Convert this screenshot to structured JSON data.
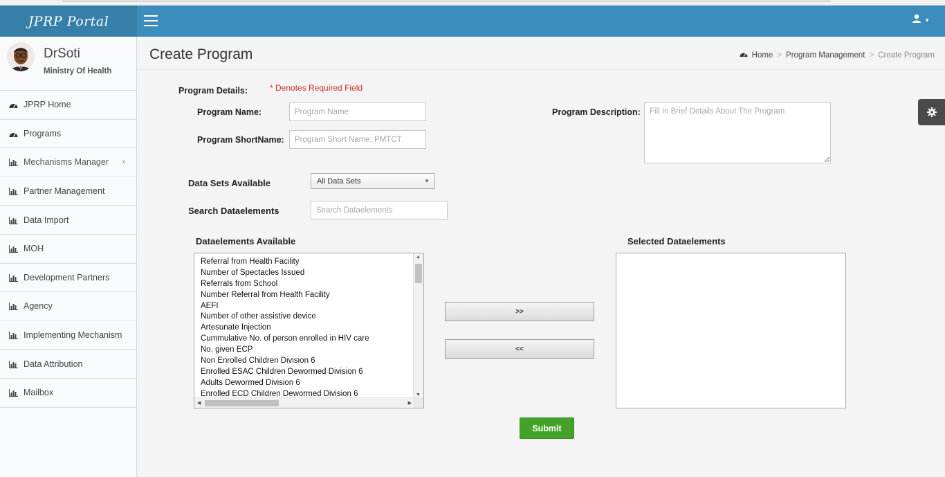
{
  "app": {
    "brand": "JPRP Portal"
  },
  "user": {
    "name": "DrSoti",
    "organization": "Ministry Of Health"
  },
  "sidebar": {
    "items": [
      {
        "label": "JPRP Home",
        "icon": "dashboard-icon"
      },
      {
        "label": "Programs",
        "icon": "dashboard-icon"
      },
      {
        "label": "Mechanisms Manager",
        "icon": "bar-chart-icon",
        "chevron": "‹"
      },
      {
        "label": "Partner Management",
        "icon": "bar-chart-icon"
      },
      {
        "label": "Data Import",
        "icon": "bar-chart-icon"
      },
      {
        "label": "MOH",
        "icon": "bar-chart-icon"
      },
      {
        "label": "Development Partners",
        "icon": "bar-chart-icon"
      },
      {
        "label": "Agency",
        "icon": "bar-chart-icon"
      },
      {
        "label": "Implementing Mechanism",
        "icon": "bar-chart-icon"
      },
      {
        "label": "Data Attribution",
        "icon": "bar-chart-icon"
      },
      {
        "label": "Mailbox",
        "icon": "bar-chart-icon"
      }
    ]
  },
  "header": {
    "title": "Create Program",
    "breadcrumb": {
      "home": "Home",
      "section": "Program Management",
      "current": "Create Program"
    }
  },
  "form": {
    "details_label": "Program Details:",
    "required_note": "* Denotes Required Field",
    "program_name_label": "Program Name:",
    "program_name_placeholder": "Program Name",
    "program_shortname_label": "Program ShortName:",
    "program_shortname_placeholder": "Program Short Name: PMTCT",
    "program_description_label": "Program Description:",
    "program_description_placeholder": "Fill In Brief Details About The Program",
    "datasets_label": "Data Sets Available",
    "datasets_selected": "All Data Sets",
    "search_label": "Search Dataelements",
    "search_placeholder": "Search Dataelements",
    "available_label": "Dataelements Available",
    "selected_label": "Selected Dataelements",
    "available_items": [
      "Referral from Health Facility",
      "Number of Spectacles Issued",
      "Referrals from School",
      "Number Referral from Health Facility",
      "AEFI",
      "Number of other assistive device",
      "Artesunate Injection",
      "Cummulative No. of person enrolled in HIV care",
      "No. given ECP",
      "Non Enrolled Children Division 6",
      "Enrolled ESAC Children Dewormed Division 6",
      "Adults Dewormed Division 6",
      "Enrolled ECD Children Dewormed Division 6"
    ],
    "add_button": ">>",
    "remove_button": "<<",
    "submit_button": "Submit"
  },
  "colors": {
    "topbar": "#3c8dbc",
    "brand_bar": "#367fa9",
    "submit": "#43a328",
    "required": "#c9302c"
  }
}
